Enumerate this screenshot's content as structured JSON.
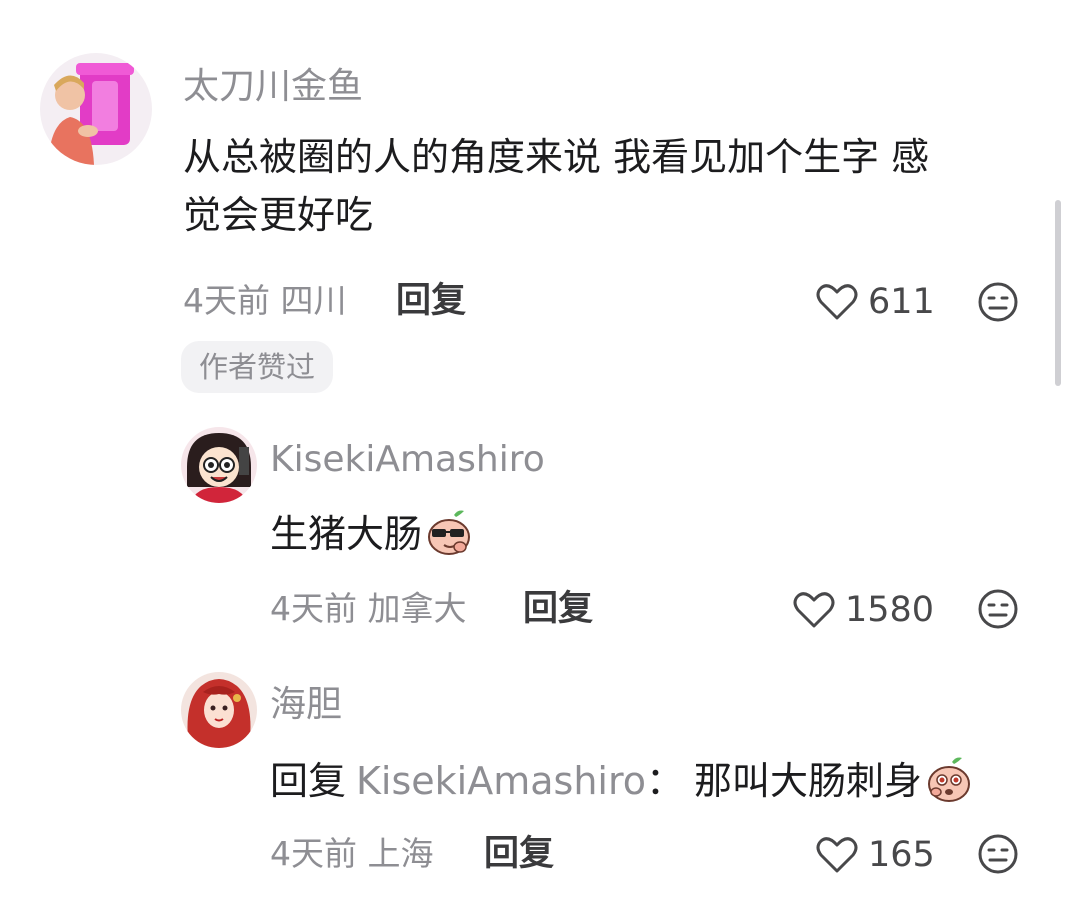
{
  "comments": [
    {
      "username": "太刀川金鱼",
      "content_line1": "从总被圈的人的角度来说 我看见加个生字 感",
      "content_line2": "觉会更好吃",
      "time": "4天前",
      "location": "四川",
      "reply_label": "回复",
      "likes": "611",
      "badge": "作者赞过",
      "avatar_icon": "avatar-pink-trashcan"
    },
    {
      "username": "KisekiAmashiro",
      "content": "生猪大肠",
      "content_emoji": "sunglasses-peach-emoji",
      "time": "4天前",
      "location": "加拿大",
      "reply_label": "回复",
      "likes": "1580",
      "avatar_icon": "avatar-cartoon-girl"
    },
    {
      "username": "海胆",
      "reply_prefix": "回复",
      "reply_target": "KisekiAmashiro",
      "colon": "：",
      "content": "那叫大肠刺身",
      "content_emoji": "shocked-peach-emoji",
      "time": "4天前",
      "location": "上海",
      "reply_label": "回复",
      "likes": "165",
      "avatar_icon": "avatar-red-hair-girl"
    }
  ],
  "colors": {
    "meta_gray": "#8e8e93",
    "text_dark": "#1c1c1e",
    "badge_bg": "#f2f2f4"
  },
  "icons": {
    "like": "heart-outline-icon",
    "dislike": "frown-face-icon"
  }
}
